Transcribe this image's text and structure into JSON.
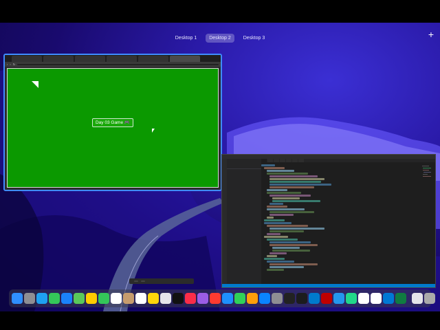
{
  "mission_control": {
    "desktops": [
      "Desktop 1",
      "Desktop 2",
      "Desktop 3"
    ],
    "active_desktop": "Desktop 2",
    "add_desktop_label": "+"
  },
  "browser": {
    "tabs": [
      "",
      "",
      "",
      "",
      "",
      ""
    ],
    "url": "",
    "game": {
      "button_label": "Day 03 Game 🎮",
      "background_color": "#0b9900"
    }
  },
  "editor": {
    "title": "",
    "tabs": [
      "",
      "",
      "",
      "",
      "",
      "",
      ""
    ],
    "files": [
      "",
      "",
      "",
      "",
      "",
      "",
      "",
      "",
      "",
      "",
      "",
      "",
      "",
      "",
      ""
    ],
    "status_left": ""
  },
  "notification": {
    "text": "",
    "button1": "",
    "button2": ""
  },
  "dock": {
    "icons": [
      {
        "name": "finder-icon",
        "color": "#2f8fff"
      },
      {
        "name": "launchpad-icon",
        "color": "#8e8e93"
      },
      {
        "name": "safari-icon",
        "color": "#1ea1f2"
      },
      {
        "name": "messages-icon",
        "color": "#34c759"
      },
      {
        "name": "mail-icon",
        "color": "#1a82fb"
      },
      {
        "name": "maps-icon",
        "color": "#5ac85a"
      },
      {
        "name": "photos-icon",
        "color": "#ffcc00"
      },
      {
        "name": "facetime-icon",
        "color": "#34c759"
      },
      {
        "name": "calendar-icon",
        "color": "#ffffff"
      },
      {
        "name": "contacts-icon",
        "color": "#c69c6d"
      },
      {
        "name": "reminders-icon",
        "color": "#ffffff"
      },
      {
        "name": "notes-icon",
        "color": "#ffd60a"
      },
      {
        "name": "freeform-icon",
        "color": "#e5e5ea"
      },
      {
        "name": "appletv-icon",
        "color": "#111111"
      },
      {
        "name": "music-icon",
        "color": "#fa2d48"
      },
      {
        "name": "podcasts-icon",
        "color": "#9b5de5"
      },
      {
        "name": "news-icon",
        "color": "#ff3b30"
      },
      {
        "name": "keynote-icon",
        "color": "#1e90ff"
      },
      {
        "name": "numbers-icon",
        "color": "#30d158"
      },
      {
        "name": "pages-icon",
        "color": "#ff9f0a"
      },
      {
        "name": "appstore-icon",
        "color": "#0a84ff"
      },
      {
        "name": "settings-icon",
        "color": "#8e8e93"
      },
      {
        "name": "quicktime-icon",
        "color": "#222222"
      },
      {
        "name": "terminal-icon",
        "color": "#1c1c1e"
      },
      {
        "name": "vscode-icon",
        "color": "#007acc"
      },
      {
        "name": "filezilla-icon",
        "color": "#bf0000"
      },
      {
        "name": "docker-icon",
        "color": "#2496ed"
      },
      {
        "name": "pycharm-icon",
        "color": "#21d789"
      },
      {
        "name": "preview-icon",
        "color": "#ffffff"
      },
      {
        "name": "chrome-icon",
        "color": "#ffffff"
      },
      {
        "name": "outlook-icon",
        "color": "#0078d4"
      },
      {
        "name": "excel-icon",
        "color": "#107c41"
      },
      {
        "name": "document-icon",
        "color": "#e5e5ea"
      },
      {
        "name": "trash-icon",
        "color": "#aaaaaa"
      }
    ]
  }
}
